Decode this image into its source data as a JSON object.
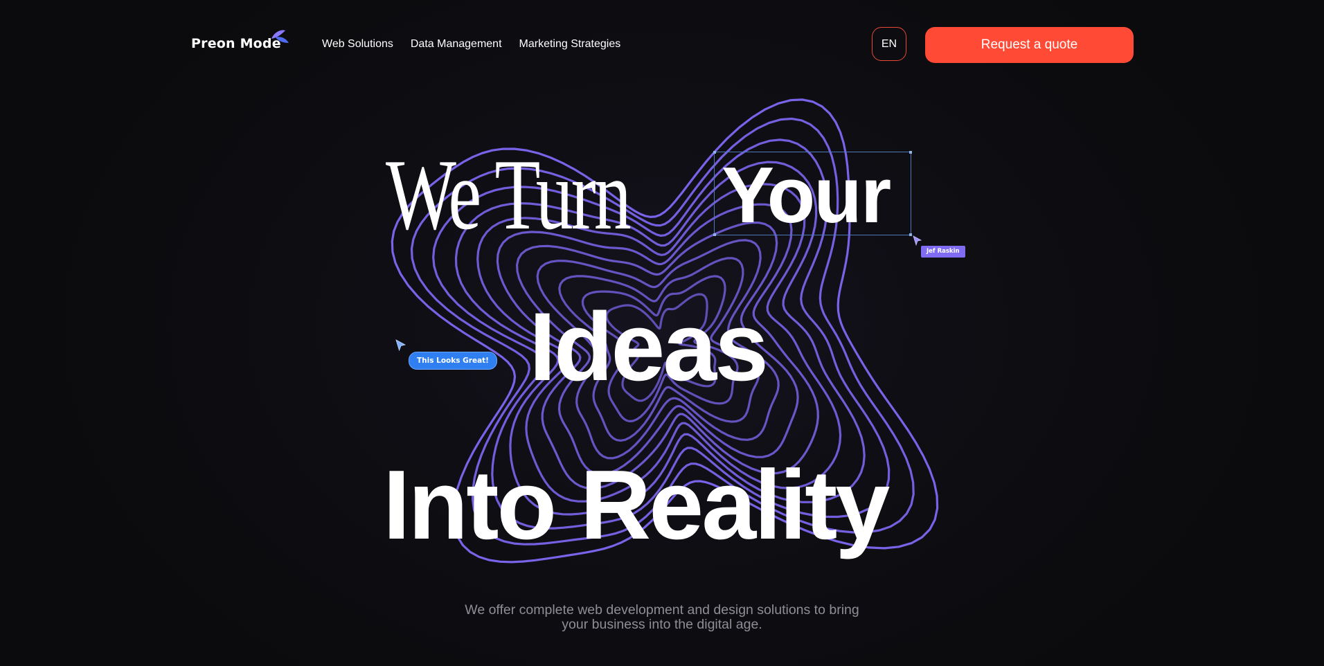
{
  "header": {
    "logo_text": "Preon Mode",
    "nav": [
      {
        "label": "Web Solutions"
      },
      {
        "label": "Data Management"
      },
      {
        "label": "Marketing Strategies"
      }
    ],
    "lang_label": "EN",
    "cta_label": "Request a quote"
  },
  "hero": {
    "line1_serif": "We Turn",
    "line1_bold": "Your",
    "line2": "Ideas",
    "line3": "Into Reality",
    "subtitle": "We offer complete web development and design solutions to bring your business into the digital age.",
    "collab_tags": [
      {
        "label": "Jef Raskin"
      },
      {
        "label": "This Looks Great!"
      }
    ]
  },
  "colors": {
    "background": "#0b0b0d",
    "accent": "#ff4a36",
    "contour": "#7a63e8",
    "tag_purple": "#7f6cf2",
    "tag_blue": "#2f7ff0"
  },
  "icons": [
    "leaf-logo-icon",
    "cursor-arrow-icon"
  ]
}
